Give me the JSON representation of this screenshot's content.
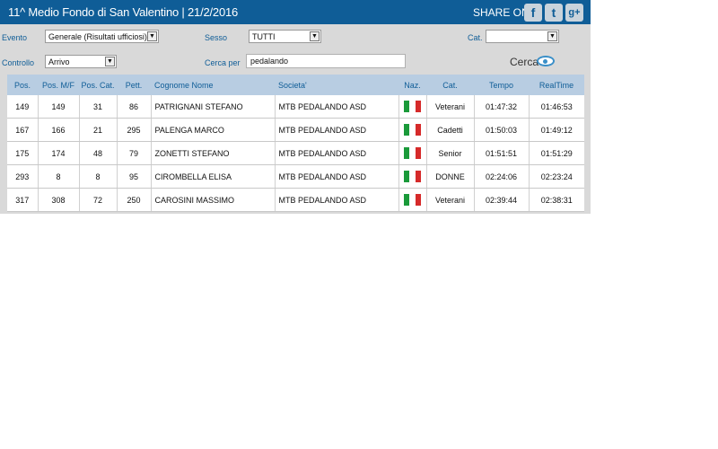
{
  "header": {
    "title": "11^ Medio Fondo di San Valentino  |  21/2/2016",
    "share_label": "SHARE ON",
    "social": [
      {
        "icon": "facebook-icon",
        "glyph": "f"
      },
      {
        "icon": "twitter-icon",
        "glyph": "t"
      },
      {
        "icon": "google-plus-icon",
        "glyph": "g+"
      }
    ]
  },
  "filters": {
    "evento": {
      "label": "Evento",
      "value": "Generale (Risultati ufficiosi)"
    },
    "sesso": {
      "label": "Sesso",
      "value": "TUTTI"
    },
    "cat": {
      "label": "Cat.",
      "value": ""
    },
    "controllo": {
      "label": "Controllo",
      "value": "Arrivo"
    },
    "cerca_per": {
      "label": "Cerca per",
      "value": "pedalando"
    },
    "cerca_button": "Cerca"
  },
  "table": {
    "headers": [
      "Pos.",
      "Pos. M/F",
      "Pos. Cat.",
      "Pett.",
      "Cognome Nome",
      "Societa'",
      "Naz.",
      "Cat.",
      "Tempo",
      "RealTime"
    ],
    "rows": [
      [
        "149",
        "149",
        "31",
        "86",
        "PATRIGNANI STEFANO",
        "MTB PEDALANDO ASD",
        "",
        "Veterani",
        "01:47:32",
        "01:46:53"
      ],
      [
        "167",
        "166",
        "21",
        "295",
        "PALENGA MARCO",
        "MTB PEDALANDO ASD",
        "",
        "Cadetti",
        "01:50:03",
        "01:49:12"
      ],
      [
        "175",
        "174",
        "48",
        "79",
        "ZONETTI STEFANO",
        "MTB PEDALANDO ASD",
        "",
        "Senior",
        "01:51:51",
        "01:51:29"
      ],
      [
        "293",
        "8",
        "8",
        "95",
        "CIROMBELLA ELISA",
        "MTB PEDALANDO ASD",
        "",
        "DONNE",
        "02:24:06",
        "02:23:24"
      ],
      [
        "317",
        "308",
        "72",
        "250",
        "CAROSINI MASSIMO",
        "MTB PEDALANDO ASD",
        "",
        "Veterani",
        "02:39:44",
        "02:38:31"
      ]
    ]
  },
  "colors": {
    "header_bg": "#0f5d97",
    "table_header_bg": "#b8cde2",
    "flag": [
      "#1a9a3a",
      "#ffffff",
      "#d62a2a"
    ]
  }
}
